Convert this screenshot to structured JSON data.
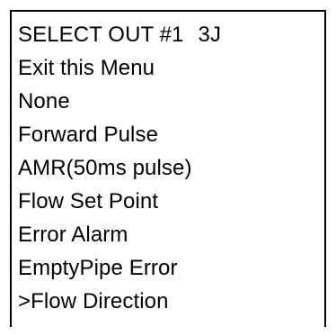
{
  "menu": {
    "title": "SELECT OUT #1",
    "code": "3J",
    "items": [
      {
        "label": "Exit this Menu"
      },
      {
        "label": "None"
      },
      {
        "label": "Forward Pulse"
      },
      {
        "label": "AMR(50ms pulse)"
      },
      {
        "label": "Flow Set Point"
      },
      {
        "label": "Error Alarm"
      },
      {
        "label": "EmptyPipe Error"
      },
      {
        "label": ">Flow Direction"
      }
    ]
  }
}
